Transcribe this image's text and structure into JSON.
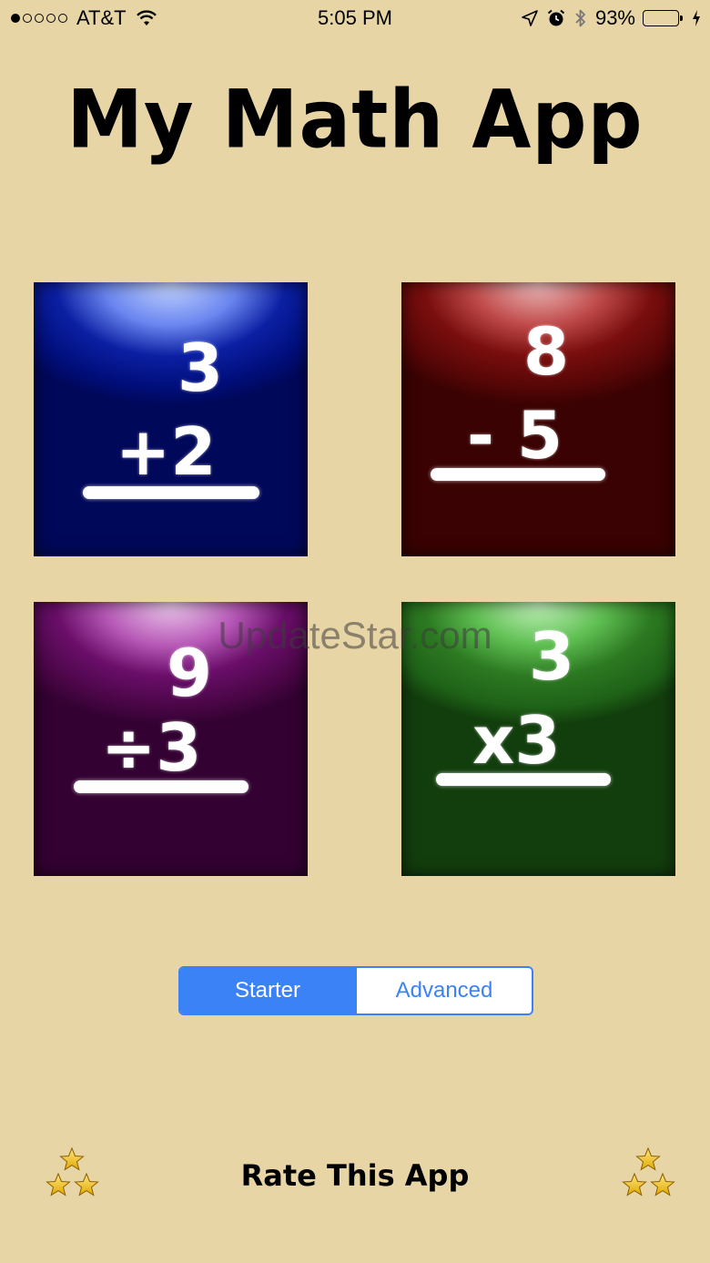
{
  "status_bar": {
    "carrier": "AT&T",
    "time": "5:05 PM",
    "battery": "93%",
    "signal_bars_filled": 1,
    "signal_bars_total": 5,
    "battery_level": 0.93
  },
  "app": {
    "title": "My Math App"
  },
  "tiles": [
    {
      "operation": "addition",
      "top": "3",
      "bottom": "+2",
      "color": "#0b1fa3"
    },
    {
      "operation": "subtraction",
      "top": "8",
      "bottom": "- 5",
      "color": "#7a0e0e"
    },
    {
      "operation": "division",
      "top": "9",
      "bottom": "÷3",
      "color": "#6a0e6a"
    },
    {
      "operation": "multiplication",
      "top": "3",
      "bottom": "x3",
      "color": "#2d7a22"
    }
  ],
  "watermark": "UpdateStar.com",
  "level_selector": {
    "options": [
      "Starter",
      "Advanced"
    ],
    "selected": "Starter",
    "accent": "#3b82f6"
  },
  "footer": {
    "rate_label": "Rate This App"
  },
  "colors": {
    "background": "#e8d5a6"
  },
  "icons": {
    "wifi": "wifi-icon",
    "location": "location-arrow-icon",
    "alarm": "alarm-clock-icon",
    "bluetooth": "bluetooth-icon",
    "charging": "charging-bolt-icon",
    "stars": "stars-icon"
  }
}
